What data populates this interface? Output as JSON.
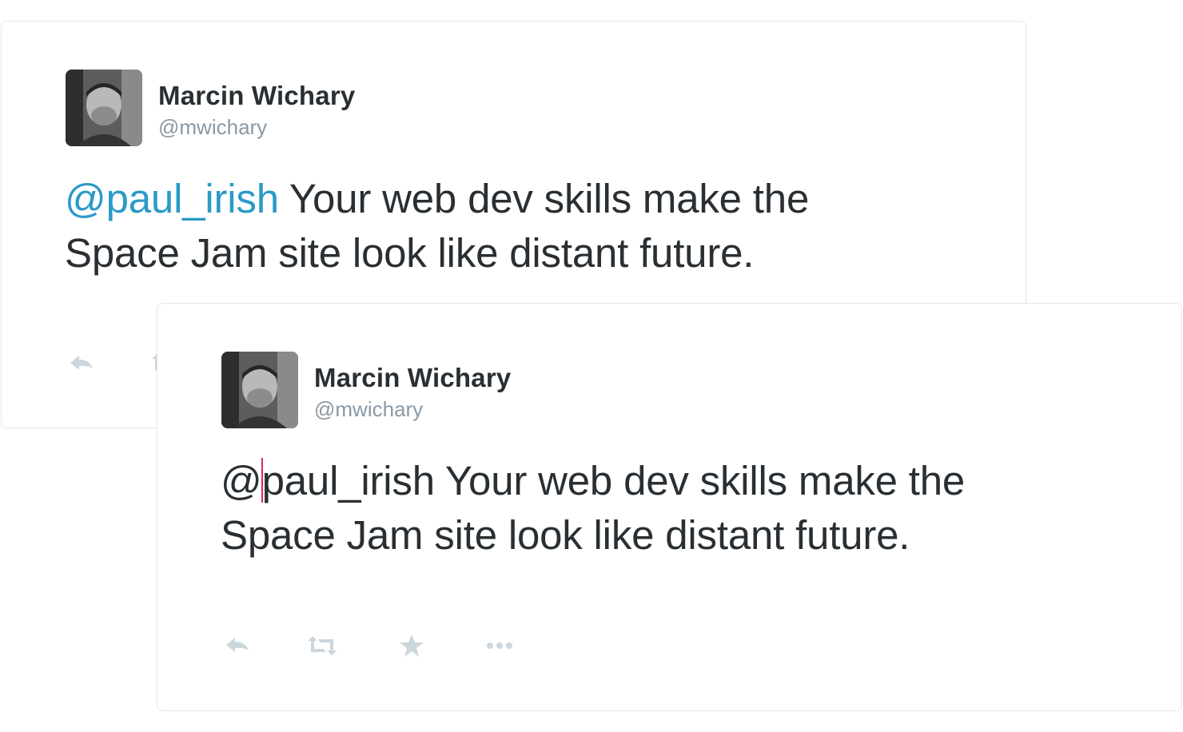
{
  "tweets": [
    {
      "author": {
        "name": "Marcin Wichary",
        "handle": "@mwichary"
      },
      "mention": "@paul_irish",
      "text_line1": " Your web dev skills make the",
      "text_line2": "Space Jam site look like distant future.",
      "state": "rendered"
    },
    {
      "author": {
        "name": "Marcin Wichary",
        "handle": "@mwichary"
      },
      "text_prefix": "@",
      "text_rest": "paul_irish Your web dev skills make the",
      "text_line2": "Space Jam site look like distant future.",
      "state": "editing"
    }
  ],
  "actions": [
    "reply-icon",
    "retweet-icon",
    "favorite-icon",
    "more-icon"
  ],
  "colors": {
    "mention": "#2b9ac7",
    "text": "#292f33",
    "handle": "#8899a6",
    "icon": "#ccd6dd",
    "border": "#e1e8ed",
    "caret": "#e0245e"
  }
}
